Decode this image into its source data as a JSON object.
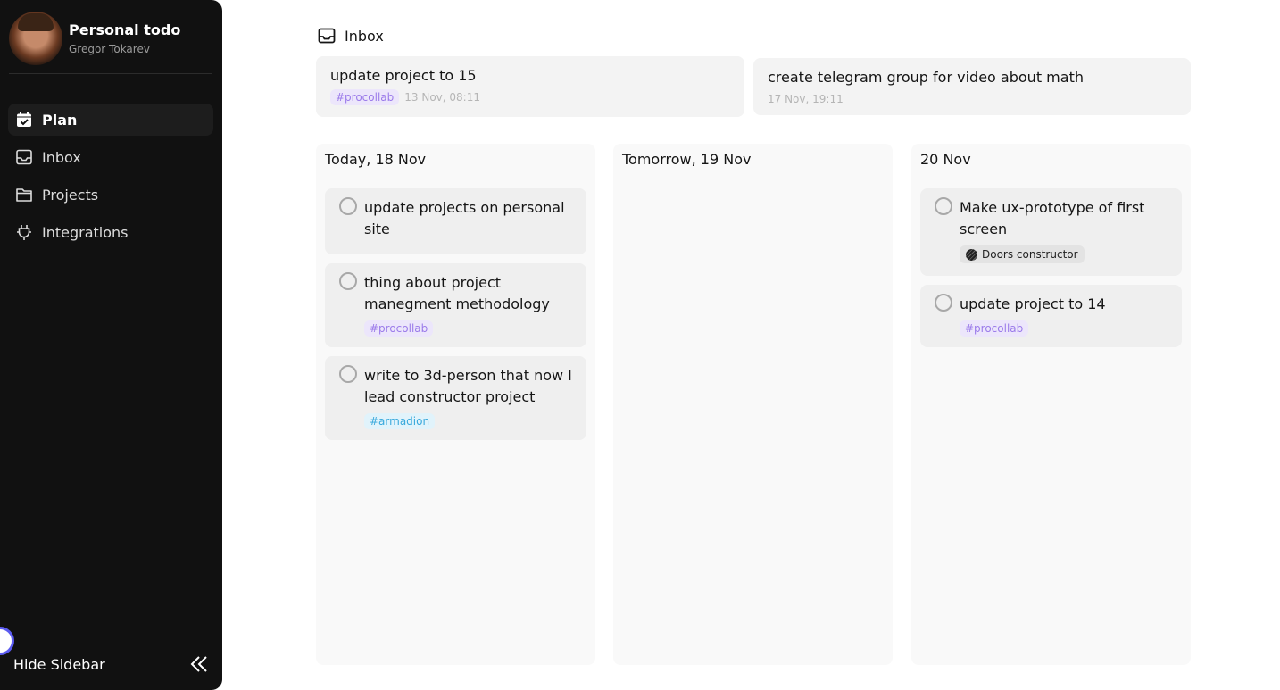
{
  "sidebar": {
    "profile": {
      "title": "Personal todo",
      "subtitle": "Gregor Tokarev"
    },
    "nav": [
      {
        "label": "Plan",
        "icon": "calendar-check-icon",
        "active": true
      },
      {
        "label": "Inbox",
        "icon": "inbox-icon",
        "active": false
      },
      {
        "label": "Projects",
        "icon": "folder-icon",
        "active": false
      },
      {
        "label": "Integrations",
        "icon": "plug-icon",
        "active": false
      }
    ],
    "hide_label": "Hide Sidebar",
    "hide_icon": "double-chevron-left-icon"
  },
  "inbox": {
    "title": "Inbox",
    "items": [
      {
        "title": "update project to 15",
        "tag": "#procollab",
        "date": "13 Nov, 08:11"
      },
      {
        "title": "create telegram group for video about math",
        "date": "17 Nov, 19:11"
      }
    ]
  },
  "columns": [
    {
      "title": "Today, 18 Nov",
      "tasks": [
        {
          "text": "update projects on personal site"
        },
        {
          "text": "thing about project manegment methodology",
          "tag": "#procollab"
        },
        {
          "text": "write to 3d-person that now I lead constructor project",
          "tag": "#armadion"
        }
      ]
    },
    {
      "title": "Tomorrow, 19 Nov",
      "tasks": []
    },
    {
      "title": "20 Nov",
      "tasks": [
        {
          "text": "Make ux-prototype of first screen",
          "project": "Doors constructor"
        },
        {
          "text": "update project to 14",
          "tag": "#procollab"
        }
      ]
    }
  ],
  "colors": {
    "sidebar_bg": "#111111",
    "card_bg": "#efefef",
    "column_bg": "#f9f9f9",
    "tag_purple": "#9b7bea",
    "tag_cyan": "#39a9dc",
    "accent_ring": "#5b5bf0"
  }
}
